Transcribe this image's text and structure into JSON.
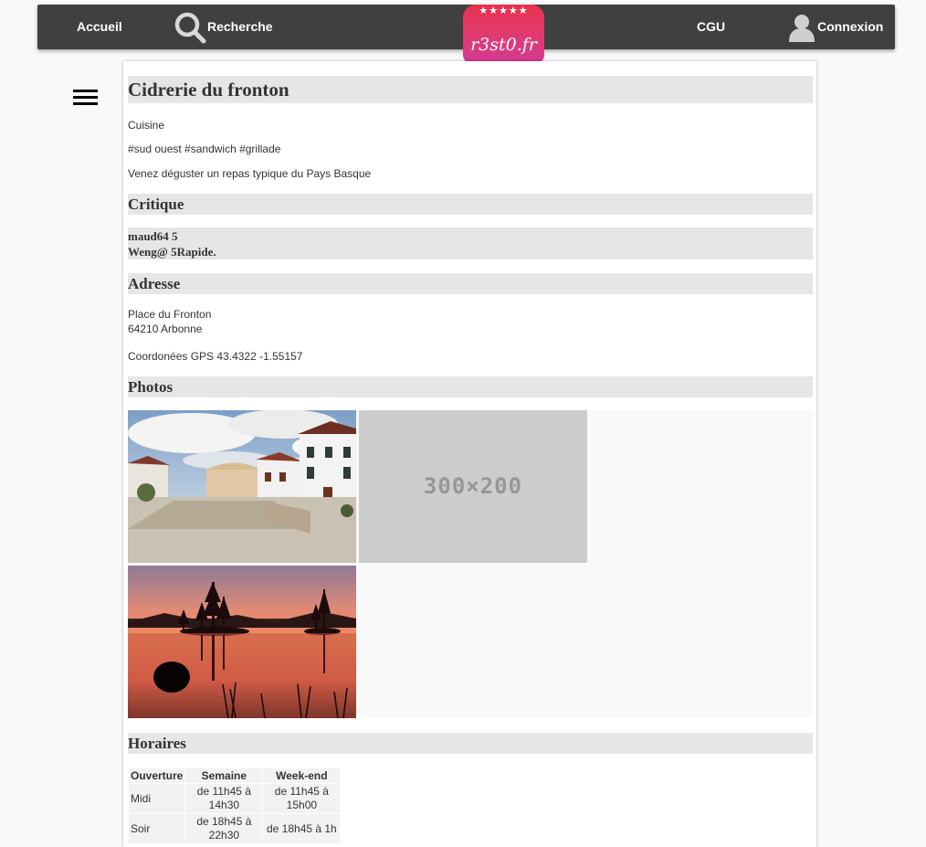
{
  "nav": {
    "home": "Accueil",
    "search": "Recherche",
    "terms": "CGU",
    "login": "Connexion",
    "logo_stars": "★★★★★",
    "logo_text": "r3st0.fr"
  },
  "restaurant": {
    "name": "Cidrerie du fronton",
    "category": "Cuisine",
    "tags": "#sud ouest #sandwich #grillade",
    "description": "Venez déguster un repas typique du Pays Basque"
  },
  "critique": {
    "heading": "Critique",
    "line1": "maud64 5",
    "line2": "Weng@ 5Rapide."
  },
  "address": {
    "heading": "Adresse",
    "street": "Place du Fronton",
    "city": "64210 Arbonne",
    "gps": "Coordonées GPS 43.4322 -1.55157"
  },
  "photos": {
    "heading": "Photos",
    "placeholder_label": "300×200"
  },
  "hours": {
    "heading": "Horaires",
    "columns": [
      "Ouverture",
      "Semaine",
      "Week-end"
    ],
    "rows": [
      {
        "label": "Midi",
        "week": "de 11h45 à 14h30",
        "weekend": "de 11h45 à 15h00"
      },
      {
        "label": "Soir",
        "week": "de 18h45 à 22h30",
        "weekend": "de 18h45 à 1h"
      }
    ]
  },
  "colors": {
    "nav_bg": "#404040",
    "band_bg": "#e6e6e6",
    "logo_gradient_top": "#e8304a",
    "logo_gradient_bottom": "#d43a95"
  }
}
